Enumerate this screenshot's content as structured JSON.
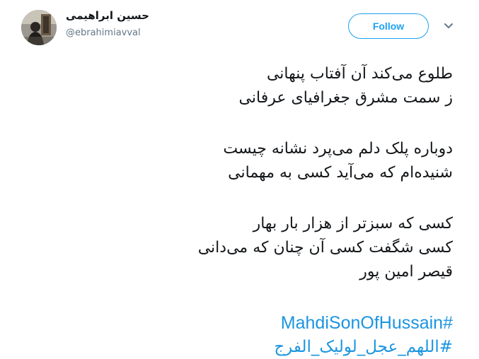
{
  "author": {
    "display_name": "حسین ابراهیمی",
    "screen_name": "@ebrahimiavval"
  },
  "actions": {
    "follow_label": "Follow",
    "more_icon": "chevron-down-icon"
  },
  "tweet": {
    "stanza1": [
      "طلوع می‌کند آن آفتاب پنهانی",
      "ز سمت مشرق جغرافیای عرفانی"
    ],
    "stanza2": [
      "دوباره پلک دلم می‌پرد نشانه چیست",
      "شنیده‌ام که می‌آید کسی به مهمانی"
    ],
    "stanza3": [
      "کسی که سبزتر از هزار بار بهار",
      "کسی شگفت کسی آن چنان که می‌دانی",
      "قیصر امین پور"
    ],
    "hashtags": [
      "#MahdiSonOfHussain",
      "#اللهم_عجل_لولیک_الفرج"
    ]
  },
  "colors": {
    "accent": "#1da1f2",
    "link": "#1b95e0",
    "text": "#14171a",
    "muted": "#657786"
  }
}
